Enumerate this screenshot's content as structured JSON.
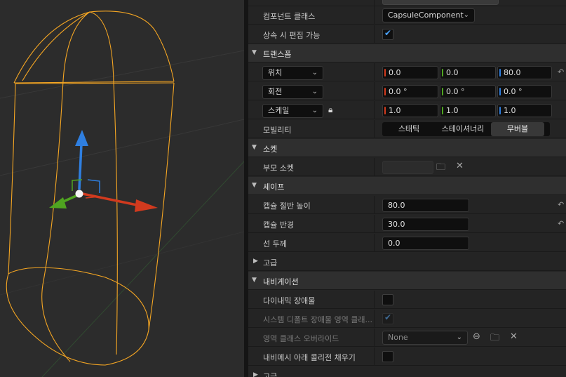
{
  "viewport": {
    "colors": {
      "capsule": "#f5a623",
      "axis_x": "#d23a1e",
      "axis_y": "#4fa420",
      "axis_z": "#2f7fe0"
    }
  },
  "details": {
    "top_partial_row": {
      "value": ""
    },
    "component_class": {
      "label": "컴포넌트 클래스",
      "value": "CapsuleComponent"
    },
    "editable_inherit": {
      "label": "상속 시 편집 가능",
      "checked": true
    },
    "transform": {
      "title": "트랜스폼",
      "location": {
        "label": "위치",
        "x": "0.0",
        "y": "0.0",
        "z": "80.0"
      },
      "rotation": {
        "label": "회전",
        "x": "0.0 °",
        "y": "0.0 °",
        "z": "0.0 °"
      },
      "scale": {
        "label": "스케일",
        "x": "1.0",
        "y": "1.0",
        "z": "1.0"
      },
      "mobility": {
        "label": "모빌리티",
        "options": [
          "스태틱",
          "스테이셔너리",
          "무버블"
        ],
        "selected": "무버블"
      }
    },
    "sockets": {
      "title": "소켓",
      "parent_socket": {
        "label": "부모 소켓",
        "value": ""
      }
    },
    "shape": {
      "title": "셰이프",
      "half_height": {
        "label": "캡슐 절반 높이",
        "value": "80.0"
      },
      "radius": {
        "label": "캡슐 반경",
        "value": "30.0"
      },
      "line_thickness": {
        "label": "선 두께",
        "value": "0.0"
      }
    },
    "advanced": {
      "title": "고급"
    },
    "navigation": {
      "title": "내비게이션",
      "dynamic_obstacle": {
        "label": "다이내믹 장애물",
        "checked": false
      },
      "system_default_area": {
        "label": "시스템 디폴트 장애물 영역 클래...",
        "checked": true
      },
      "area_class_override": {
        "label": "영역 클래스 오버라이드",
        "value": "None"
      },
      "fill_collision": {
        "label": "내비메시 아래 콜리전 채우기",
        "checked": false
      }
    },
    "advanced2": {
      "title": "고급"
    }
  }
}
